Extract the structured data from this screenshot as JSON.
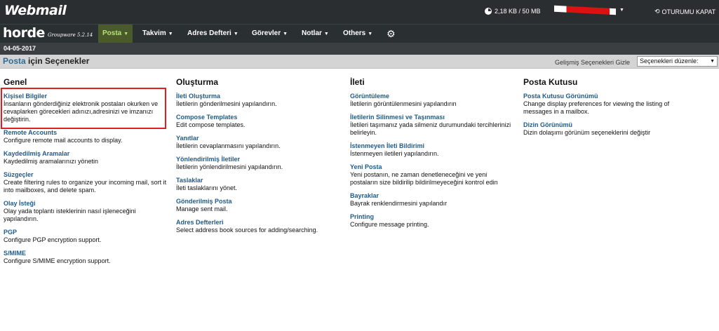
{
  "topbar": {
    "brand": "Webmail",
    "quota": "2,18 KB / 50 MB",
    "logout_label": "OTURUMU KAPAT",
    "user_redacted": true
  },
  "navbar": {
    "horde_word": "horde",
    "horde_sub": "Groupware 5.2.14",
    "items": [
      {
        "label": "Posta",
        "active": true
      },
      {
        "label": "Takvim"
      },
      {
        "label": "Adres Defteri"
      },
      {
        "label": "Görevler"
      },
      {
        "label": "Notlar"
      },
      {
        "label": "Others"
      }
    ]
  },
  "date": "04-05-2017",
  "options_header": {
    "title_app": "Posta",
    "title_rest": " için Seçenekler",
    "advanced_link": "Gelişmiş Seçenekleri Gizle",
    "select_value": "Seçenekleri düzenle:"
  },
  "columns": [
    {
      "heading": "Genel",
      "entries": [
        {
          "title": "Kişisel Bilgiler",
          "desc": "İnsanların gönderdiğiniz elektronik postaları okurken ve cevaplarken görecekleri adınızı,adresinizi ve imzanızı değiştirin."
        },
        {
          "title": "Remote Accounts",
          "desc": "Configure remote mail accounts to display."
        },
        {
          "title": "Kaydedilmiş Aramalar",
          "desc": "Kaydedilmiş aramalarınızı yönetin"
        },
        {
          "title": "Süzgeçler",
          "desc": "Create filtering rules to organize your incoming mail, sort it into mailboxes, and delete spam."
        },
        {
          "title": "Olay İsteği",
          "desc": "Olay yada toplantı isteklerinin nasıl işleneceğini yapılandırın."
        },
        {
          "title": "PGP",
          "desc": "Configure PGP encryption support."
        },
        {
          "title": "S/MIME",
          "desc": "Configure S/MIME encryption support."
        }
      ]
    },
    {
      "heading": "Oluşturma",
      "entries": [
        {
          "title": "İleti Oluşturma",
          "desc": "İletilerin gönderilmesini yapılandırın."
        },
        {
          "title": "Compose Templates",
          "desc": "Edit compose templates."
        },
        {
          "title": "Yanıtlar",
          "desc": "İletilerin cevaplanmasını yapılandırın."
        },
        {
          "title": "Yönlendirilmiş İletiler",
          "desc": "İletilerin yönlendirilmesini yapılandırın."
        },
        {
          "title": "Taslaklar",
          "desc": "İleti taslaklarını yönet."
        },
        {
          "title": "Gönderilmiş Posta",
          "desc": "Manage sent mail."
        },
        {
          "title": "Adres Defterleri",
          "desc": "Select address book sources for adding/searching."
        }
      ]
    },
    {
      "heading": "İleti",
      "entries": [
        {
          "title": "Görüntüleme",
          "desc": "İletilerin görüntülenmesini yapılandırın"
        },
        {
          "title": "İletilerin Silinmesi ve Taşınması",
          "desc": "İletileri taşımanız yada silmeniz durumundaki tercihlerinizi belirleyin."
        },
        {
          "title": "İstenmeyen İleti Bildirimi",
          "desc": "İstenmeyen iletileri yapılandırın."
        },
        {
          "title": "Yeni Posta",
          "desc": "Yeni postanın, ne zaman denetleneceğini ve yeni postaların size bildirilip bildirilmeyeceğini kontrol edin"
        },
        {
          "title": "Bayraklar",
          "desc": "Bayrak renklendirmesini yapılandır"
        },
        {
          "title": "Printing",
          "desc": "Configure message printing."
        }
      ]
    },
    {
      "heading": "Posta Kutusu",
      "entries": [
        {
          "title": "Posta Kutusu Görünümü",
          "desc": "Change display preferences for viewing the listing of messages in a mailbox."
        },
        {
          "title": "Dizin Görünümü",
          "desc": "Dizin dolaşımı görünüm seçeneklerini değiştir"
        }
      ]
    }
  ],
  "colors": {
    "topbar_bg": "#2b2e30",
    "nav_active_text": "#b7e27a",
    "link_blue": "#1e5b8a",
    "highlight_red": "#e02020"
  }
}
